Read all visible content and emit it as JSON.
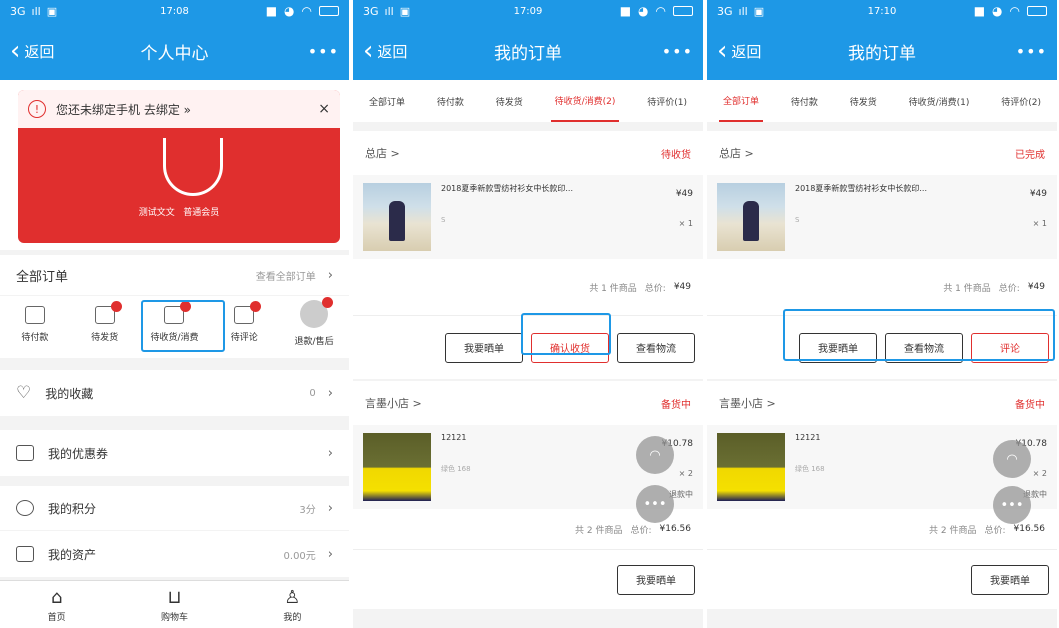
{
  "status": {
    "signal": "3G",
    "times": [
      "17:08",
      "17:09",
      "17:10"
    ]
  },
  "profile": {
    "nav": {
      "back": "返回",
      "title": "个人中心",
      "more": "•••"
    },
    "notice": {
      "text": "您还未绑定手机 去绑定 »",
      "close": "×"
    },
    "user": {
      "name": "测试文文",
      "level": "普通会员"
    },
    "orders": {
      "title": "全部订单",
      "view_all": "查看全部订单"
    },
    "order_icons": [
      {
        "label": "待付款",
        "badge": false
      },
      {
        "label": "待发货",
        "badge": true
      },
      {
        "label": "待收货/消费",
        "badge": true
      },
      {
        "label": "待评论",
        "badge": true
      },
      {
        "label": "退款/售后",
        "badge": true
      }
    ],
    "menu": [
      {
        "label": "我的收藏",
        "value": "0"
      },
      {
        "label": "我的优惠券",
        "value": ""
      },
      {
        "label": "我的积分",
        "value": "3分"
      },
      {
        "label": "我的资产",
        "value": "0.00元"
      }
    ],
    "tabbar": [
      "首页",
      "购物车",
      "我的"
    ]
  },
  "orders_page": {
    "nav": {
      "back": "返回",
      "title": "我的订单",
      "more": "•••"
    },
    "tabs_p2": [
      "全部订单",
      "待付款",
      "待发货",
      "待收货/消费(2)",
      "待评价(1)"
    ],
    "tabs_p3": [
      "全部订单",
      "待付款",
      "待发货",
      "待收货/消费(1)",
      "待评价(2)"
    ],
    "order1": {
      "shop": "总店 >",
      "status_p2": "待收货",
      "status_p3": "已完成",
      "title": "2018夏季新款雪纺衬衫女中长款印...",
      "spec": "S",
      "price": "¥49",
      "qty": "× 1",
      "summary": "共 1 件商品",
      "total_label": "总价:",
      "total": "¥49"
    },
    "buttons_p2": [
      "我要晒单",
      "确认收货",
      "查看物流"
    ],
    "buttons_p3": [
      "我要晒单",
      "查看物流",
      "评论"
    ],
    "order2": {
      "shop": "言墨小店 >",
      "status": "备货中",
      "title": "12121",
      "spec": "绿色 168",
      "price": "¥10.78",
      "qty": "× 2",
      "refund": "退款中",
      "summary": "共 2 件商品",
      "total_label": "总价:",
      "total": "¥16.56",
      "button": "我要晒单"
    },
    "float_icons": [
      "headset-icon",
      "more-dots-icon"
    ]
  },
  "colors": {
    "brand_blue": "#1e98e6",
    "accent_red": "#e02f2e",
    "orange": "#e07d20"
  }
}
